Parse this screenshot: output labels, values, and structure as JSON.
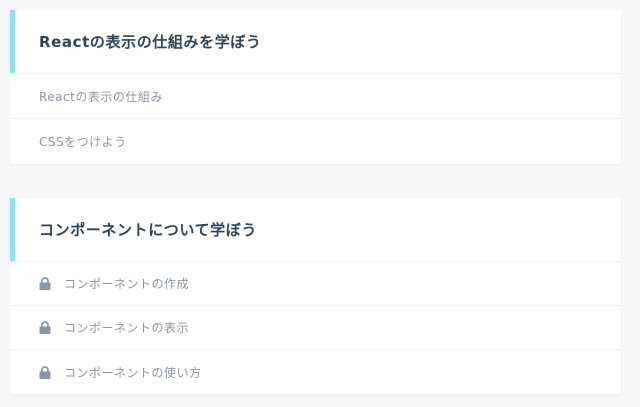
{
  "colors": {
    "page_background": "#f7f8fa",
    "card_background": "#ffffff",
    "accent": "#8ee1ee",
    "title_text": "#2f4356",
    "item_text": "#8c96a3",
    "lock_icon": "#8a96a6"
  },
  "sections": [
    {
      "title": "Reactの表示の仕組みを学ぼう",
      "lessons": [
        {
          "label": "Reactの表示の仕組み",
          "locked": false
        },
        {
          "label": "CSSをつけよう",
          "locked": false
        }
      ]
    },
    {
      "title": "コンポーネントについて学ぼう",
      "lessons": [
        {
          "label": "コンポーネントの作成",
          "locked": true,
          "icon": "lock-icon"
        },
        {
          "label": "コンポーネントの表示",
          "locked": true,
          "icon": "lock-icon"
        },
        {
          "label": "コンポーネントの使い方",
          "locked": true,
          "icon": "lock-icon"
        }
      ]
    }
  ]
}
